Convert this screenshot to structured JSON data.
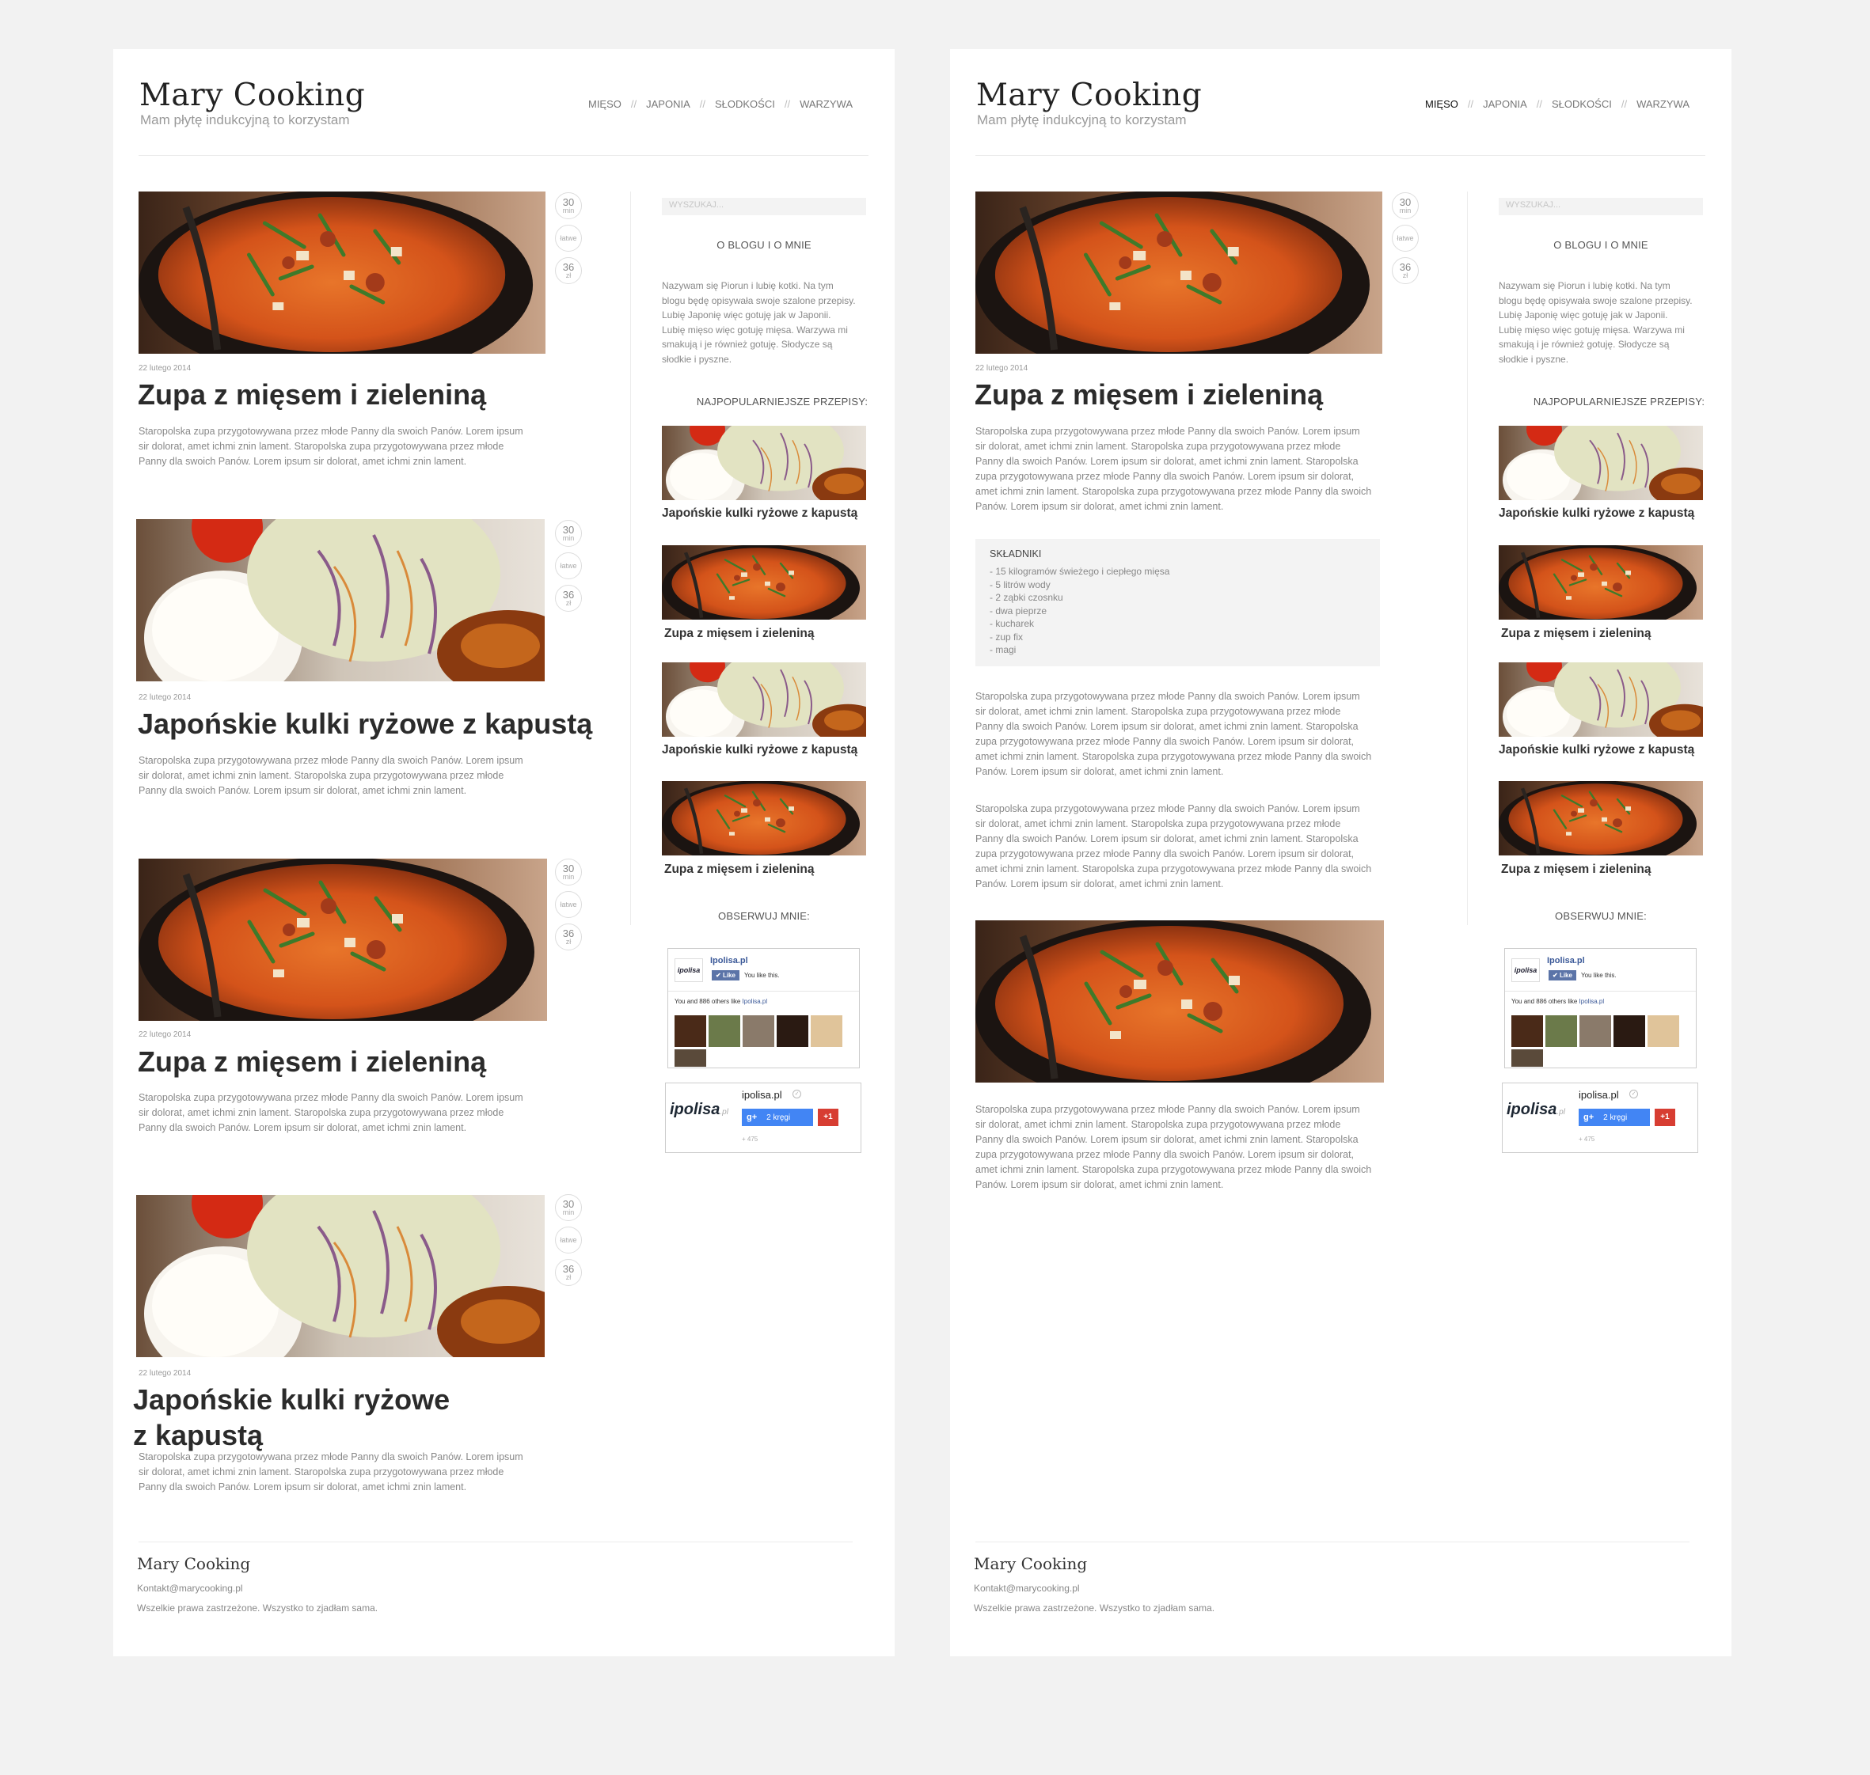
{
  "site": {
    "logo": "Mary Cooking",
    "tagline": "Mam płytę indukcyjną to korzystam",
    "nav": [
      "MIĘSO",
      "JAPONIA",
      "SŁODKOŚCI",
      "WARZYWA"
    ],
    "nav_sep": "//"
  },
  "meta": {
    "time": "30",
    "time_unit": "min",
    "difficulty": "łatwe",
    "cost": "36",
    "cost_unit": "zł"
  },
  "posts": [
    {
      "date": "22 lutego 2014",
      "title": "Zupa z mięsem i zieleniną",
      "image": "soup"
    },
    {
      "date": "22 lutego 2014",
      "title": "Japońskie kulki ryżowe z kapustą",
      "image": "rice"
    },
    {
      "date": "22 lutego 2014",
      "title": "Zupa z mięsem i zieleniną",
      "image": "soup"
    },
    {
      "date": "22 lutego 2014",
      "title_line1": "Japońskie kulki ryżowe",
      "title_line2": "z kapustą",
      "image": "rice"
    }
  ],
  "excerpt": {
    "line1": "Staropolska zupa przygotowywana  przez młode Panny dla swoich Panów. Lorem ipsum",
    "line2": "sir dolorat, amet ichmi znin lament. Staropolska zupa przygotowywana  przez młode",
    "line3": "Panny dla swoich Panów. Lorem ipsum sir dolorat, amet ichmi znin lament.",
    "line3b": "Panny dla swoich Panów. Lorem ipsum sir dolorat, amet ichmi znin lament. Staropolska",
    "line4": "zupa przygotowywana  przez młode Panny dla swoich Panów. Lorem ipsum sir dolorat,",
    "line5": "amet ichmi znin lament. Staropolska zupa przygotowywana  przez młode Panny dla swoich",
    "line6": "Panów. Lorem ipsum sir dolorat, amet ichmi znin lament."
  },
  "sidebar": {
    "search_placeholder": "WYSZUKAJ...",
    "about_heading": "O BLOGU I O MNIE",
    "about_lines": [
      "Nazywam się Piorun i lubię kotki. Na tym",
      "blogu będę opisywała swoje szalone przepisy.",
      "Lubię Japonię więc gotuję jak w Japonii.",
      "Lubię mięso więc gotuję mięsa. Warzywa mi",
      "smakują i je również gotuję. Słodycze są",
      "słodkie i pyszne."
    ],
    "popular_heading": "NAJPOPULARNIEJSZE PRZEPISY:",
    "popular": [
      {
        "title": "Japońskie kulki ryżowe z kapustą",
        "image": "rice"
      },
      {
        "title": "Zupa z mięsem i zieleniną",
        "image": "soup"
      },
      {
        "title": "Japońskie kulki ryżowe z kapustą",
        "image": "rice"
      },
      {
        "title": "Zupa z mięsem i zieleniną",
        "image": "soup"
      }
    ],
    "follow_heading": "OBSERWUJ MNIE:",
    "fb": {
      "name": "Ipolisa.pl",
      "like": "Like",
      "you_like": "You like this.",
      "others_a": "You and 886 others like ",
      "others_b": "Ipolisa.pl"
    },
    "gplus": {
      "brand": "ipolisa",
      "brand_suffix": ".pl",
      "name": "ipolisa.pl",
      "circles": "2 kręgi",
      "plus_one": "+1",
      "count": "+ 475"
    }
  },
  "ingredients": {
    "heading": "SKŁADNIKI",
    "items": [
      "- 15 kilogramów świeżego i ciepłego mięsa",
      "- 5 litrów wody",
      "- 2 ząbki czosnku",
      "- dwa pieprze",
      "- kucharek",
      "- zup fix",
      "- magi"
    ]
  },
  "footer": {
    "logo": "Mary Cooking",
    "contact": "Kontakt@marycooking.pl",
    "copyright": "Wszelkie prawa zastrzeżone. Wszystko to zjadłam sama."
  },
  "colors": {
    "fb_blue": "#3b5998",
    "gplus_blue": "#4285f4",
    "gplus_red": "#d73d32"
  }
}
